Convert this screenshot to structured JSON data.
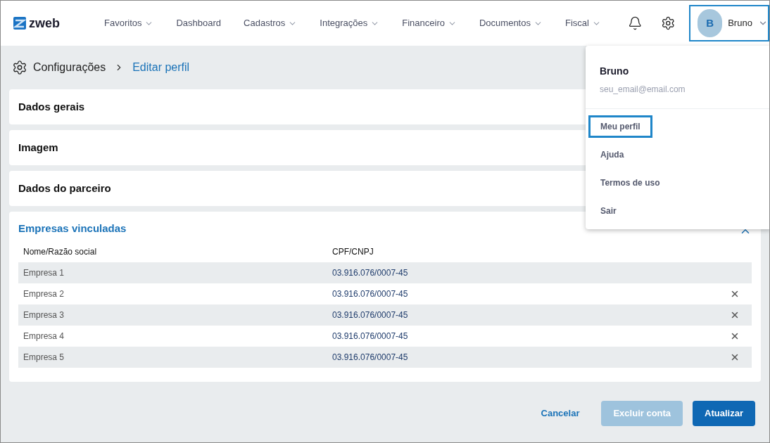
{
  "logo": {
    "text": "zweb"
  },
  "nav": [
    {
      "label": "Favoritos",
      "dropdown": true
    },
    {
      "label": "Dashboard",
      "dropdown": false
    },
    {
      "label": "Cadastros",
      "dropdown": true
    },
    {
      "label": "Integrações",
      "dropdown": true
    },
    {
      "label": "Financeiro",
      "dropdown": true
    },
    {
      "label": "Documentos",
      "dropdown": true
    },
    {
      "label": "Fiscal",
      "dropdown": true
    }
  ],
  "user": {
    "initial": "B",
    "name": "Bruno",
    "focused": true
  },
  "user_menu": {
    "name": "Bruno",
    "email": "seu_email@email.com",
    "items": [
      {
        "label": "Meu perfil",
        "selected": true
      },
      {
        "label": "Ajuda",
        "selected": false
      },
      {
        "label": "Termos de uso",
        "selected": false
      },
      {
        "label": "Sair",
        "selected": false
      }
    ]
  },
  "breadcrumb": {
    "root": "Configurações",
    "current": "Editar perfil"
  },
  "sections": [
    {
      "title": "Dados gerais"
    },
    {
      "title": "Imagem"
    },
    {
      "title": "Dados do parceiro"
    }
  ],
  "companies": {
    "title": "Empresas vinculadas",
    "columns": [
      "Nome/Razão social",
      "CPF/CNPJ"
    ],
    "rows": [
      {
        "name": "Empresa 1",
        "doc": "03.916.076/0007-45",
        "removable": false
      },
      {
        "name": "Empresa 2",
        "doc": "03.916.076/0007-45",
        "removable": true
      },
      {
        "name": "Empresa 3",
        "doc": "03.916.076/0007-45",
        "removable": true
      },
      {
        "name": "Empresa 4",
        "doc": "03.916.076/0007-45",
        "removable": true
      },
      {
        "name": "Empresa 5",
        "doc": "03.916.076/0007-45",
        "removable": true
      }
    ]
  },
  "actions": [
    {
      "label": "Cancelar",
      "kind": "link",
      "disabled": false
    },
    {
      "label": "Excluir conta",
      "kind": "secondary",
      "disabled": true
    },
    {
      "label": "Atualizar",
      "kind": "primary",
      "disabled": false
    }
  ]
}
